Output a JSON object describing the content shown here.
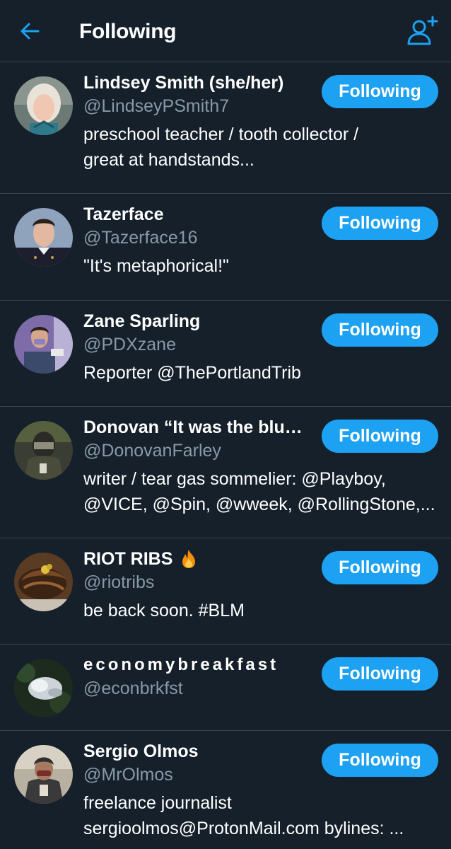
{
  "header": {
    "title": "Following"
  },
  "colors": {
    "background": "#15202b",
    "divider": "#38444d",
    "accent": "#1da1f2",
    "secondary_text": "#8899a6"
  },
  "users": [
    {
      "name": "Lindsey Smith (she/her)",
      "handle": "@LindseyPSmith7",
      "bio_lines": [
        "preschool teacher / tooth collector /",
        "great at handstands..."
      ],
      "button": "Following"
    },
    {
      "name": "Tazerface",
      "handle": "@Tazerface16",
      "bio_lines": [
        "\"It's metaphorical!\""
      ],
      "button": "Following"
    },
    {
      "name": "Zane Sparling",
      "handle": "@PDXzane",
      "bio_lines": [
        "Reporter @ThePortlandTrib"
      ],
      "button": "Following"
    },
    {
      "name": "Donovan “It was the blurs...",
      "handle": "@DonovanFarley",
      "bio_lines": [
        "writer / tear gas sommelier: @Playboy,",
        "@VICE, @Spin, @wweek, @RollingStone,..."
      ],
      "button": "Following"
    },
    {
      "name": "RIOT RIBS",
      "name_icon": "fire-icon",
      "handle": "@riotribs",
      "bio_lines": [
        "be back soon. #BLM"
      ],
      "button": "Following"
    },
    {
      "name": "economybreakfast",
      "handle": "@econbrkfst",
      "bio_lines": [],
      "button": "Following"
    },
    {
      "name": "Sergio Olmos",
      "handle": "@MrOlmos",
      "bio_lines": [
        "freelance journalist",
        "sergioolmos@ProtonMail.com bylines: ..."
      ],
      "button": "Following"
    }
  ]
}
